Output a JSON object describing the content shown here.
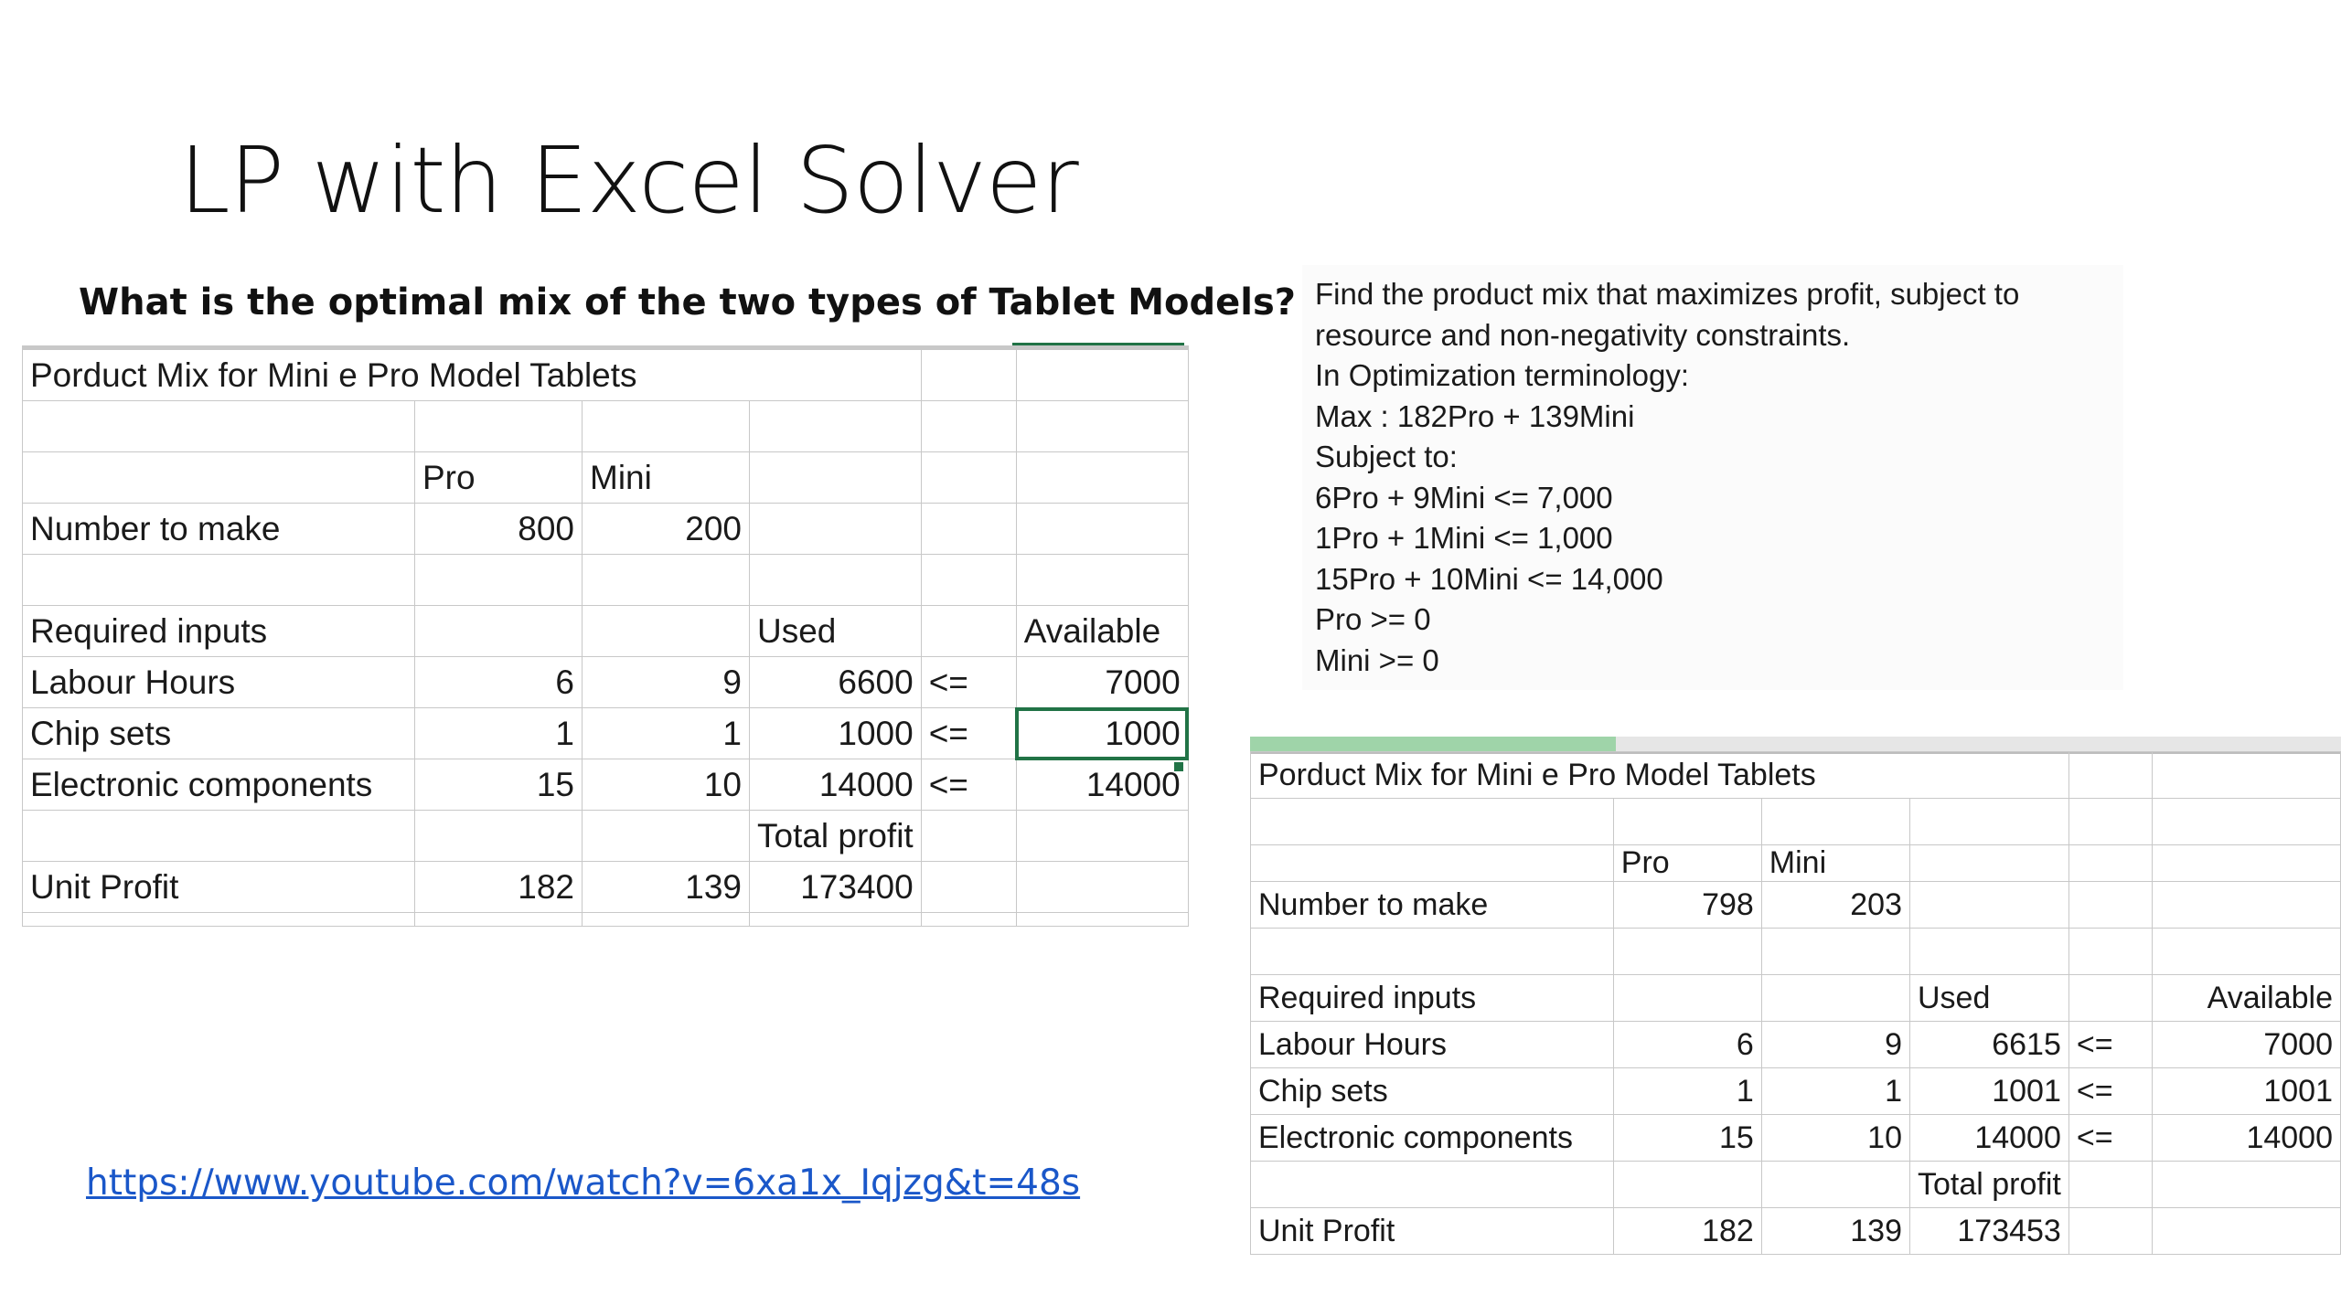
{
  "slide": {
    "title": "LP with Excel Solver",
    "question": "What is the optimal mix of the two types of Tablet Models?",
    "link": "https://www.youtube.com/watch?v=6xa1x_Iqjzg&t=48s"
  },
  "problem": {
    "lines": [
      "Find the product mix that maximizes profit, subject to",
      "resource and non-negativity constraints.",
      "In Optimization terminology:",
      "Max : 182Pro + 139Mini",
      "Subject to:",
      "6Pro + 9Mini <= 7,000",
      "1Pro + 1Mini <= 1,000",
      "15Pro + 10Mini <= 14,000",
      "Pro >= 0",
      "Mini >= 0"
    ]
  },
  "sheet1": {
    "title": "Porduct Mix for Mini e Pro Model Tablets",
    "col_pro": "Pro",
    "col_mini": "Mini",
    "number_label": "Number to make",
    "number_pro": "800",
    "number_mini": "200",
    "req_label": "Required inputs",
    "used_label": "Used",
    "available_label": "Available",
    "rows": [
      {
        "label": "Labour Hours",
        "pro": "6",
        "mini": "9",
        "used": "6600",
        "op": "<=",
        "avail": "7000"
      },
      {
        "label": "Chip sets",
        "pro": "1",
        "mini": "1",
        "used": "1000",
        "op": "<=",
        "avail": "1000"
      },
      {
        "label": "Electronic components",
        "pro": "15",
        "mini": "10",
        "used": "14000",
        "op": "<=",
        "avail": "14000"
      }
    ],
    "total_label": "Total profit",
    "unit_label": "Unit Profit",
    "unit_pro": "182",
    "unit_mini": "139",
    "total_value": "173400"
  },
  "sheet2": {
    "title": "Porduct Mix for Mini e Pro Model Tablets",
    "col_pro": "Pro",
    "col_mini": "Mini",
    "number_label": "Number to make",
    "number_pro": "798",
    "number_mini": "203",
    "req_label": "Required inputs",
    "used_label": "Used",
    "available_label": "Available",
    "rows": [
      {
        "label": "Labour Hours",
        "pro": "6",
        "mini": "9",
        "used": "6615",
        "op": "<=",
        "avail": "7000"
      },
      {
        "label": "Chip sets",
        "pro": "1",
        "mini": "1",
        "used": "1001",
        "op": "<=",
        "avail": "1001"
      },
      {
        "label": "Electronic components",
        "pro": "15",
        "mini": "10",
        "used": "14000",
        "op": "<=",
        "avail": "14000"
      }
    ],
    "total_label": "Total profit",
    "unit_label": "Unit Profit",
    "unit_pro": "182",
    "unit_mini": "139",
    "total_value": "173453"
  },
  "colors": {
    "excel_green": "#217346",
    "link_blue": "#1a57c9",
    "gridline": "#c8c8c8"
  }
}
